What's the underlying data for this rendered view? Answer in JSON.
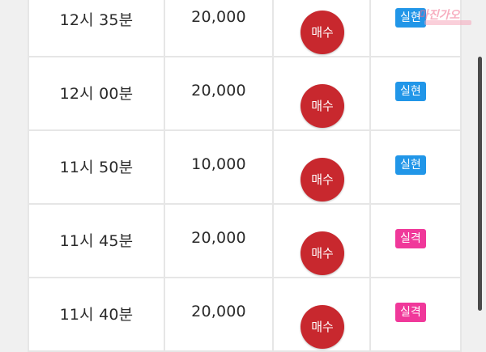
{
  "rows": [
    {
      "time": "12시 35분",
      "amount": "20,000",
      "action": "매수",
      "result": "실현",
      "result_color": "#2196e8"
    },
    {
      "time": "12시 00분",
      "amount": "20,000",
      "action": "매수",
      "result": "실현",
      "result_color": "#2196e8"
    },
    {
      "time": "11시 50분",
      "amount": "10,000",
      "action": "매수",
      "result": "실현",
      "result_color": "#2196e8"
    },
    {
      "time": "11시 45분",
      "amount": "20,000",
      "action": "매수",
      "result": "실격",
      "result_color": "#f0389a"
    },
    {
      "time": "11시 40분",
      "amount": "20,000",
      "action": "매수",
      "result": "실격",
      "result_color": "#f0389a"
    }
  ],
  "colors": {
    "buy_button": "#c8282e",
    "realized": "#2196e8",
    "disqualified": "#f0389a"
  },
  "watermark": {
    "text": "마진가오"
  }
}
